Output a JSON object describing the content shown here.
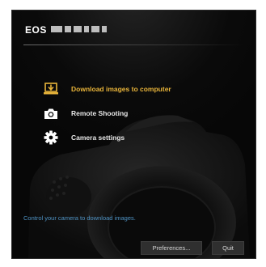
{
  "header": {
    "brand": "EOS"
  },
  "menu": {
    "items": [
      {
        "label": "Download images to computer",
        "icon": "download-to-computer-icon",
        "active": true
      },
      {
        "label": "Remote Shooting",
        "icon": "camera-icon",
        "active": false
      },
      {
        "label": "Camera settings",
        "icon": "gear-icon",
        "active": false
      }
    ]
  },
  "hint": "Control your camera to download images.",
  "buttons": {
    "preferences": "Preferences...",
    "quit": "Quit"
  },
  "colors": {
    "background": "#070707",
    "accent": "#e8b43a",
    "hint": "#4f93c4",
    "button": "#2f2f2f"
  }
}
